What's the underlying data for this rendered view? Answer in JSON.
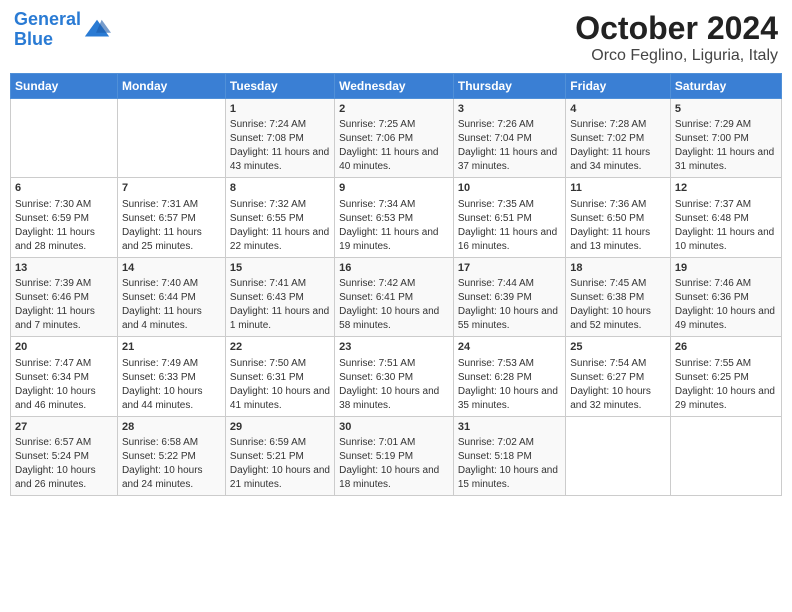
{
  "header": {
    "logo_line1": "General",
    "logo_line2": "Blue",
    "title": "October 2024",
    "subtitle": "Orco Feglino, Liguria, Italy"
  },
  "days_of_week": [
    "Sunday",
    "Monday",
    "Tuesday",
    "Wednesday",
    "Thursday",
    "Friday",
    "Saturday"
  ],
  "weeks": [
    [
      {
        "day": "",
        "info": ""
      },
      {
        "day": "",
        "info": ""
      },
      {
        "day": "1",
        "info": "Sunrise: 7:24 AM\nSunset: 7:08 PM\nDaylight: 11 hours and 43 minutes."
      },
      {
        "day": "2",
        "info": "Sunrise: 7:25 AM\nSunset: 7:06 PM\nDaylight: 11 hours and 40 minutes."
      },
      {
        "day": "3",
        "info": "Sunrise: 7:26 AM\nSunset: 7:04 PM\nDaylight: 11 hours and 37 minutes."
      },
      {
        "day": "4",
        "info": "Sunrise: 7:28 AM\nSunset: 7:02 PM\nDaylight: 11 hours and 34 minutes."
      },
      {
        "day": "5",
        "info": "Sunrise: 7:29 AM\nSunset: 7:00 PM\nDaylight: 11 hours and 31 minutes."
      }
    ],
    [
      {
        "day": "6",
        "info": "Sunrise: 7:30 AM\nSunset: 6:59 PM\nDaylight: 11 hours and 28 minutes."
      },
      {
        "day": "7",
        "info": "Sunrise: 7:31 AM\nSunset: 6:57 PM\nDaylight: 11 hours and 25 minutes."
      },
      {
        "day": "8",
        "info": "Sunrise: 7:32 AM\nSunset: 6:55 PM\nDaylight: 11 hours and 22 minutes."
      },
      {
        "day": "9",
        "info": "Sunrise: 7:34 AM\nSunset: 6:53 PM\nDaylight: 11 hours and 19 minutes."
      },
      {
        "day": "10",
        "info": "Sunrise: 7:35 AM\nSunset: 6:51 PM\nDaylight: 11 hours and 16 minutes."
      },
      {
        "day": "11",
        "info": "Sunrise: 7:36 AM\nSunset: 6:50 PM\nDaylight: 11 hours and 13 minutes."
      },
      {
        "day": "12",
        "info": "Sunrise: 7:37 AM\nSunset: 6:48 PM\nDaylight: 11 hours and 10 minutes."
      }
    ],
    [
      {
        "day": "13",
        "info": "Sunrise: 7:39 AM\nSunset: 6:46 PM\nDaylight: 11 hours and 7 minutes."
      },
      {
        "day": "14",
        "info": "Sunrise: 7:40 AM\nSunset: 6:44 PM\nDaylight: 11 hours and 4 minutes."
      },
      {
        "day": "15",
        "info": "Sunrise: 7:41 AM\nSunset: 6:43 PM\nDaylight: 11 hours and 1 minute."
      },
      {
        "day": "16",
        "info": "Sunrise: 7:42 AM\nSunset: 6:41 PM\nDaylight: 10 hours and 58 minutes."
      },
      {
        "day": "17",
        "info": "Sunrise: 7:44 AM\nSunset: 6:39 PM\nDaylight: 10 hours and 55 minutes."
      },
      {
        "day": "18",
        "info": "Sunrise: 7:45 AM\nSunset: 6:38 PM\nDaylight: 10 hours and 52 minutes."
      },
      {
        "day": "19",
        "info": "Sunrise: 7:46 AM\nSunset: 6:36 PM\nDaylight: 10 hours and 49 minutes."
      }
    ],
    [
      {
        "day": "20",
        "info": "Sunrise: 7:47 AM\nSunset: 6:34 PM\nDaylight: 10 hours and 46 minutes."
      },
      {
        "day": "21",
        "info": "Sunrise: 7:49 AM\nSunset: 6:33 PM\nDaylight: 10 hours and 44 minutes."
      },
      {
        "day": "22",
        "info": "Sunrise: 7:50 AM\nSunset: 6:31 PM\nDaylight: 10 hours and 41 minutes."
      },
      {
        "day": "23",
        "info": "Sunrise: 7:51 AM\nSunset: 6:30 PM\nDaylight: 10 hours and 38 minutes."
      },
      {
        "day": "24",
        "info": "Sunrise: 7:53 AM\nSunset: 6:28 PM\nDaylight: 10 hours and 35 minutes."
      },
      {
        "day": "25",
        "info": "Sunrise: 7:54 AM\nSunset: 6:27 PM\nDaylight: 10 hours and 32 minutes."
      },
      {
        "day": "26",
        "info": "Sunrise: 7:55 AM\nSunset: 6:25 PM\nDaylight: 10 hours and 29 minutes."
      }
    ],
    [
      {
        "day": "27",
        "info": "Sunrise: 6:57 AM\nSunset: 5:24 PM\nDaylight: 10 hours and 26 minutes."
      },
      {
        "day": "28",
        "info": "Sunrise: 6:58 AM\nSunset: 5:22 PM\nDaylight: 10 hours and 24 minutes."
      },
      {
        "day": "29",
        "info": "Sunrise: 6:59 AM\nSunset: 5:21 PM\nDaylight: 10 hours and 21 minutes."
      },
      {
        "day": "30",
        "info": "Sunrise: 7:01 AM\nSunset: 5:19 PM\nDaylight: 10 hours and 18 minutes."
      },
      {
        "day": "31",
        "info": "Sunrise: 7:02 AM\nSunset: 5:18 PM\nDaylight: 10 hours and 15 minutes."
      },
      {
        "day": "",
        "info": ""
      },
      {
        "day": "",
        "info": ""
      }
    ]
  ]
}
